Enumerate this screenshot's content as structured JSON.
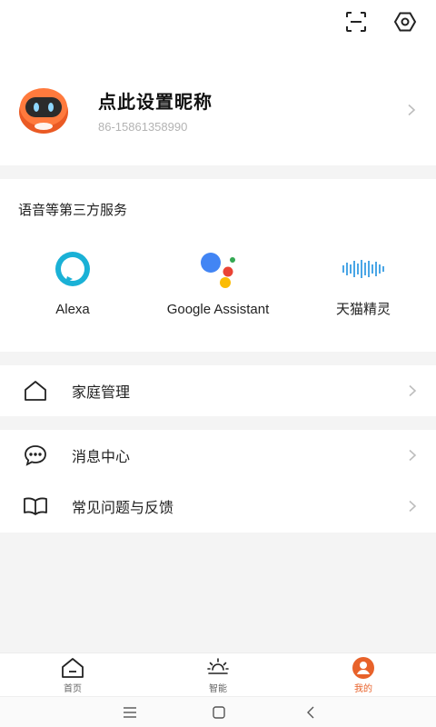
{
  "header": {
    "scan_icon": "scan-icon",
    "settings_icon": "settings-hex-icon"
  },
  "profile": {
    "nickname": "点此设置昵称",
    "phone": "86-15861358990",
    "avatar_icon": "robot-avatar"
  },
  "services": {
    "title": "语音等第三方服务",
    "items": [
      {
        "label": "Alexa",
        "icon": "alexa-icon"
      },
      {
        "label": "Google Assistant",
        "icon": "google-assistant-icon"
      },
      {
        "label": "天猫精灵",
        "icon": "tmall-genie-icon"
      }
    ]
  },
  "menu": {
    "home_management": "家庭管理",
    "messages": "消息中心",
    "faq_feedback": "常见问题与反馈"
  },
  "tabbar": {
    "home": "首页",
    "smart": "智能",
    "me": "我的",
    "active": "我的",
    "accent_color": "#e8622a"
  },
  "colors": {
    "accent": "#e8622a",
    "alexa": "#1ab1d6",
    "page_bg": "#f4f4f4"
  }
}
